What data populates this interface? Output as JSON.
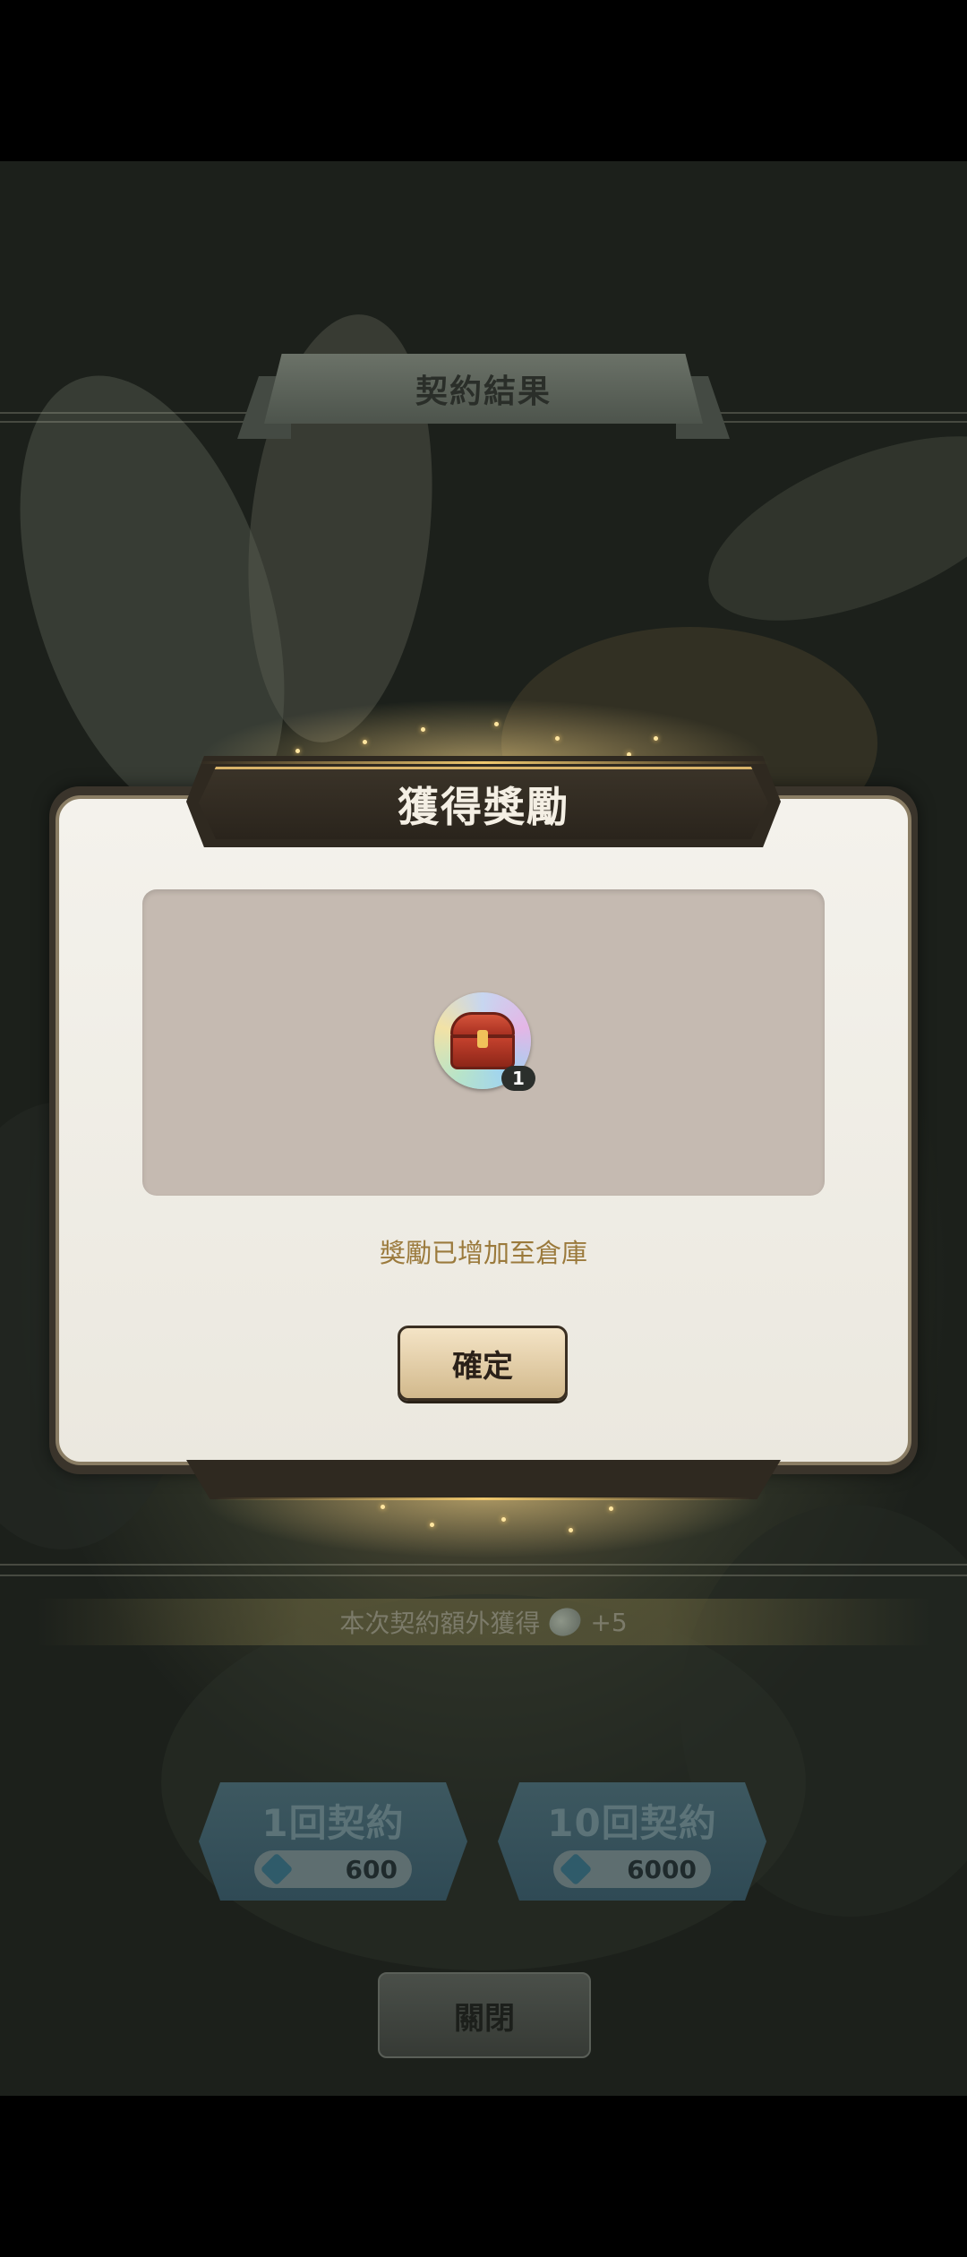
{
  "background": {
    "header_title": "契約結果",
    "bonus_text": "本次契約額外獲得",
    "bonus_icon": "crystal-icon",
    "bonus_amount": "+5",
    "pull_one": {
      "label": "1回契約",
      "cost": "600",
      "cost_icon": "gem-icon"
    },
    "pull_ten": {
      "label": "10回契約",
      "cost": "6000",
      "cost_icon": "gem-icon"
    },
    "close_label": "關閉"
  },
  "modal": {
    "title": "獲得獎勵",
    "reward": {
      "icon": "treasure-chest-icon",
      "quantity": "1"
    },
    "notice": "獎勵已增加至倉庫",
    "confirm_label": "確定"
  },
  "colors": {
    "modal_title_bar": "#2f2920",
    "modal_panel": "#f4f2ec",
    "reward_box": "#c5bab1",
    "notice_text": "#9b7a3c",
    "confirm_button": "#e6d2ad",
    "gold_accent": "#f0c86e"
  }
}
